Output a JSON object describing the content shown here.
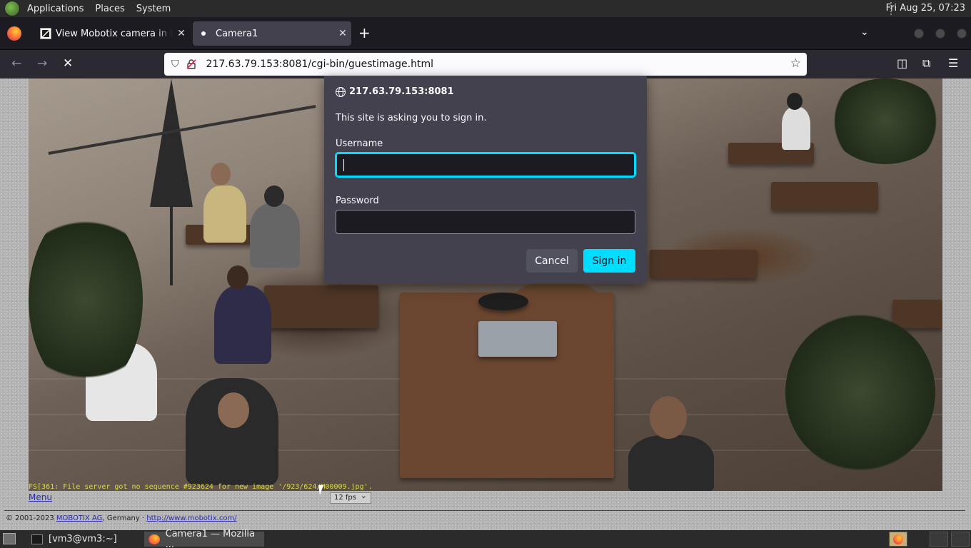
{
  "topbar": {
    "menus": [
      "Applications",
      "Places",
      "System"
    ],
    "clock": "Fri Aug 25, 07:23"
  },
  "browser": {
    "tabs": [
      {
        "label": "View Mobotix camera in Net",
        "active": false
      },
      {
        "label": "Camera1",
        "active": true
      }
    ],
    "url": "217.63.79.153:8081/cgi-bin/guestimage.html"
  },
  "page": {
    "overlay_text": "FS[361: File server got no sequence #923624 for new image '/923/624/M00009.jpg'.",
    "menu_link": "Menu",
    "fps_value": "12 fps",
    "copyright_prefix": "© 2001-2023 ",
    "copyright_company": "MOBOTIX AG",
    "copyright_mid": ", Germany · ",
    "copyright_url": "http://www.mobotix.com/"
  },
  "dialog": {
    "host": "217.63.79.153:8081",
    "message": "This site is asking you to sign in.",
    "username_label": "Username",
    "username_value": "",
    "password_label": "Password",
    "password_value": "",
    "cancel_label": "Cancel",
    "signin_label": "Sign in"
  },
  "taskbar": {
    "tasks": [
      {
        "label": "[vm3@vm3:~]",
        "icon": "terminal-icon"
      },
      {
        "label": "Camera1 — Mozilla ...",
        "icon": "firefox-icon",
        "active": true
      }
    ]
  },
  "colors": {
    "accent": "#00ddff",
    "dialog_bg": "#42414d",
    "toolbar_bg": "#2b2a33"
  }
}
